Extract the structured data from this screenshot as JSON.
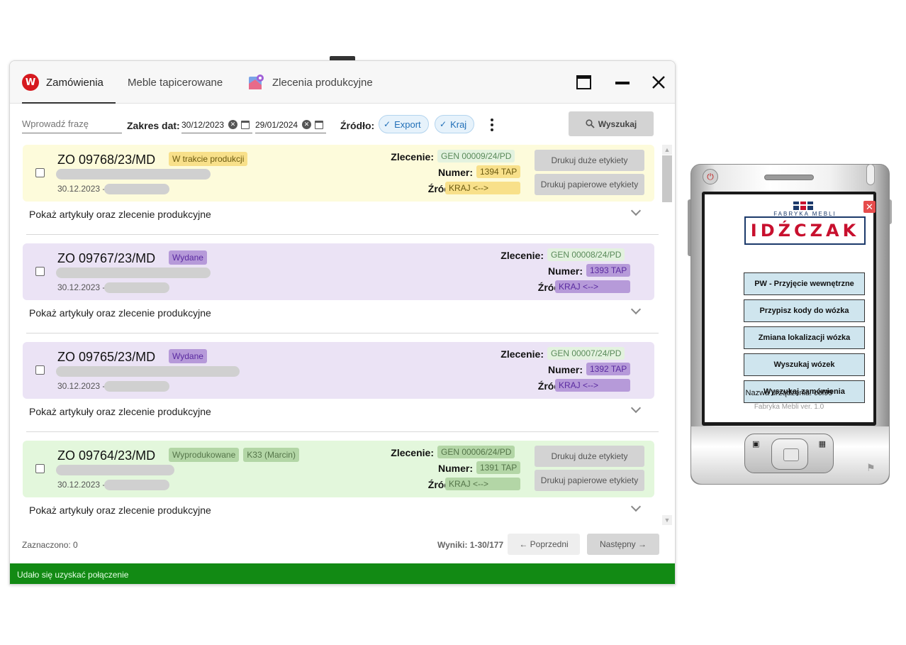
{
  "app": {
    "tabs": [
      {
        "label": "Zamówienia",
        "active": true,
        "icon": "w-logo-icon"
      },
      {
        "label": "Meble tapicerowane",
        "active": false
      },
      {
        "label": "Zlecenia produkcyjne",
        "active": false,
        "icon": "map-icon"
      }
    ],
    "window_controls": [
      "maximize-icon",
      "minimize-icon",
      "close-icon"
    ]
  },
  "filters": {
    "search_placeholder": "Wprowadź frazę",
    "date_range_label": "Zakres dat:",
    "date_from": "30/12/2023",
    "date_to": "29/01/2024",
    "source_label": "Źródło:",
    "source_chips": [
      "Export",
      "Kraj"
    ],
    "search_button": "Wyszukaj"
  },
  "labels": {
    "zlecenie": "Zlecenie:",
    "numer": "Numer:",
    "zrodlo": "Źródło:",
    "print_big": "Drukuj duże etykiety",
    "print_paper": "Drukuj papierowe etykiety",
    "expand": "Pokaż artykuły oraz zlecenie produkcyjne",
    "date_suffix": "-"
  },
  "orders": [
    {
      "number": "ZO 09768/23/MD",
      "badges": [
        "W trakcie produkcji"
      ],
      "date": "30.12.2023",
      "zlecenie": "GEN 00009/24/PD",
      "numer": "1394 TAP",
      "zrodlo": "KRAJ <-->",
      "theme": "yellow",
      "has_print": true
    },
    {
      "number": "ZO 09767/23/MD",
      "badges": [
        "Wydane"
      ],
      "date": "30.12.2023",
      "zlecenie": "GEN 00008/24/PD",
      "numer": "1393 TAP",
      "zrodlo": "KRAJ <-->",
      "theme": "purple",
      "has_print": false
    },
    {
      "number": "ZO 09765/23/MD",
      "badges": [
        "Wydane"
      ],
      "date": "30.12.2023",
      "zlecenie": "GEN 00007/24/PD",
      "numer": "1392 TAP",
      "zrodlo": "KRAJ <-->",
      "theme": "purple",
      "has_print": false
    },
    {
      "number": "ZO 09764/23/MD",
      "badges": [
        "Wyprodukowane",
        "K33 (Marcin)"
      ],
      "date": "30.12.2023",
      "zlecenie": "GEN 00006/24/PD",
      "numer": "1391 TAP",
      "zrodlo": "KRAJ <-->",
      "theme": "green",
      "has_print": true
    }
  ],
  "themes": {
    "yellow": {
      "bg": "#fdfbdb",
      "badge_bg": "#f8e08a",
      "badge_fg": "#6b5a10",
      "gen_bg": "#e3f2df",
      "gen_fg": "#5a8a5a",
      "val_bg": "#f8e08a",
      "val_fg": "#6b5a10"
    },
    "purple": {
      "bg": "#ebe3f5",
      "badge_bg": "#b69ad9",
      "badge_fg": "#5a2aa0",
      "gen_bg": "#e3f2df",
      "gen_fg": "#5a8a5a",
      "val_bg": "#b69ad9",
      "val_fg": "#5a2aa0"
    },
    "green": {
      "bg": "#e3f7dc",
      "badge_bg": "#b3d6a6",
      "badge_fg": "#55754a",
      "gen_bg": "#b3d6a6",
      "gen_fg": "#55754a",
      "val_bg": "#b3d6a6",
      "val_fg": "#55754a"
    }
  },
  "footer": {
    "selected": "Zaznaczono: 0",
    "results": "Wyniki: 1-30/177",
    "prev": "← Poprzedni",
    "next": "Następny →"
  },
  "status": {
    "text": "Udało się uzyskać połączenie",
    "color": "#128a14"
  },
  "pda": {
    "brand_sub": "FABRYKA MEBLI",
    "brand_name": "IDŹCZAK",
    "buttons": [
      "PW - Przyjęcie wewnętrzne",
      "Przypisz kody do wózka",
      "Zmiana lokalizacji wózka",
      "Wyszukaj wózek",
      "Wyszukaj zamówienia"
    ],
    "device_name": "Nazwa urządzenia: col99",
    "version": "Fabryka Mebli ver. 1.0"
  }
}
